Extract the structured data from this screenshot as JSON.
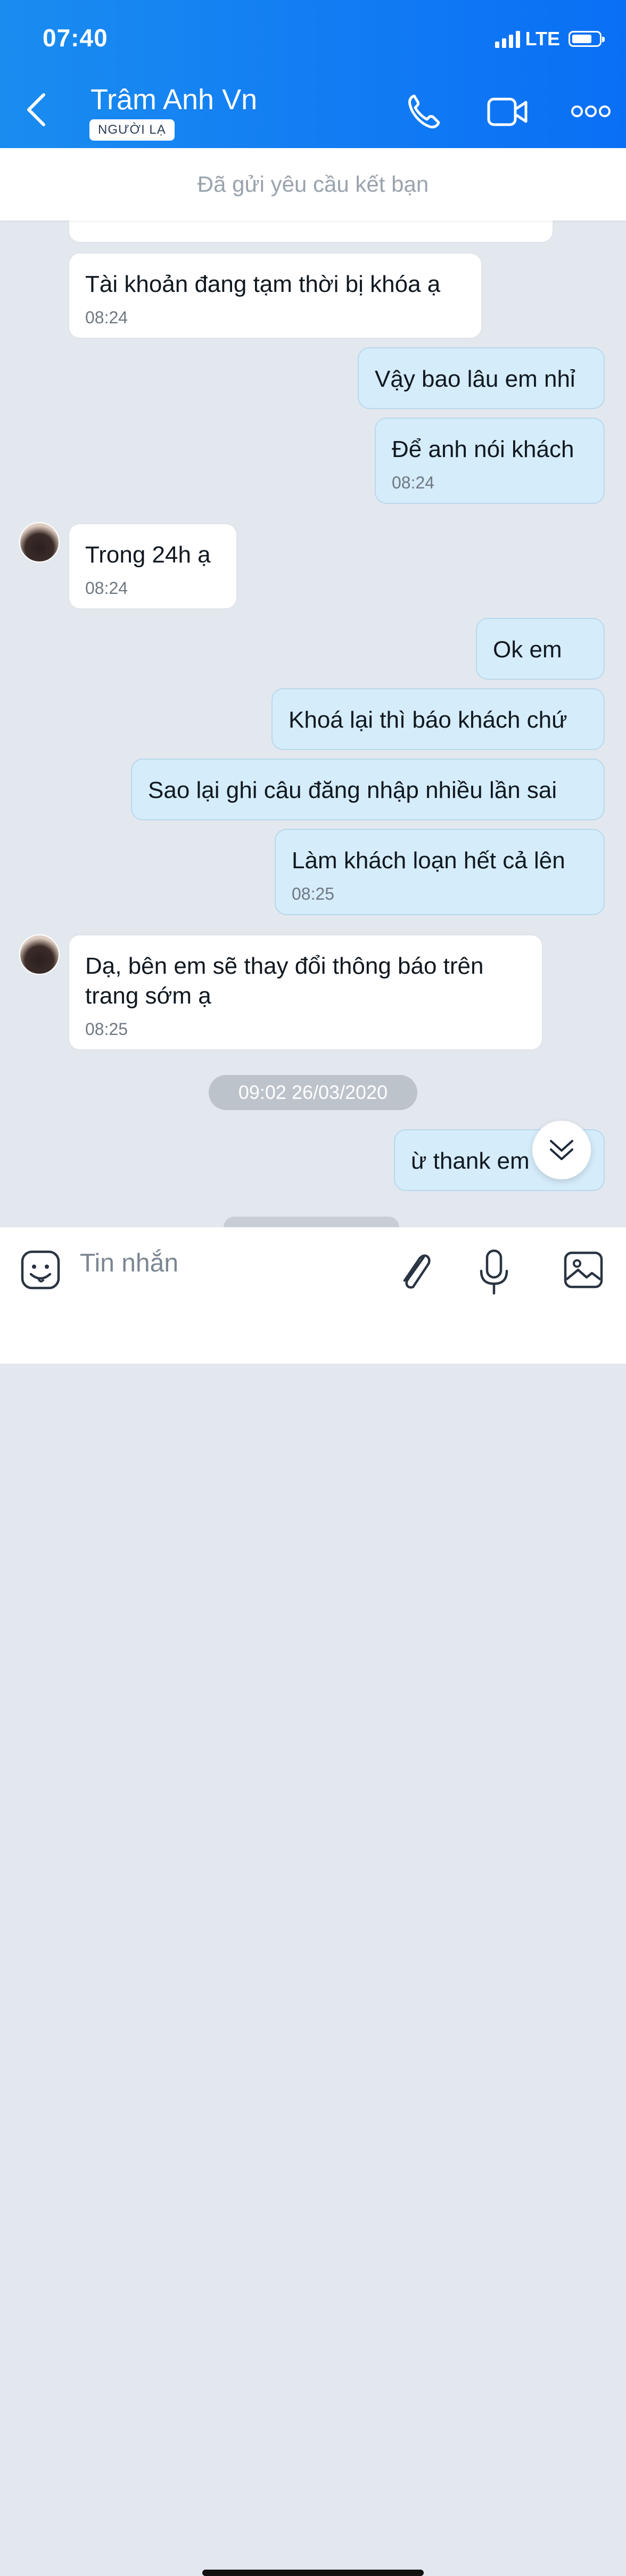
{
  "status_bar": {
    "time": "07:40",
    "network": "LTE"
  },
  "header": {
    "contact_name": "Trâm Anh Vn",
    "badge": "NGƯỜI LẠ",
    "accent_color": "#0a78f5",
    "icons": [
      "back-chevron-icon",
      "phone-icon",
      "video-call-icon",
      "more-options-icon"
    ]
  },
  "friend_request_bar": {
    "text": "Đã gửi yêu cầu kết bạn"
  },
  "messages": [
    {
      "side": "in",
      "text": "Tài khoản đang tạm thời bị khóa ạ",
      "time": "08:24"
    },
    {
      "side": "out",
      "text": "Vậy bao lâu em nhỉ"
    },
    {
      "side": "out",
      "text": "Để anh nói khách",
      "time": "08:24"
    },
    {
      "side": "in",
      "text": "Trong 24h ạ",
      "time": "08:24"
    },
    {
      "side": "out",
      "text": "Ok em"
    },
    {
      "side": "out",
      "text": "Khoá lại thì báo khách chứ"
    },
    {
      "side": "out",
      "text": "Sao lại ghi câu đăng nhập nhiều lần sai"
    },
    {
      "side": "out",
      "text": "Làm khách loạn hết cả lên",
      "time": "08:25"
    },
    {
      "side": "in",
      "text": "Dạ, bên em sẽ thay đổi thông báo trên trang sớm ạ",
      "time": "08:25"
    },
    {
      "side": "out",
      "text": "ừ thank em"
    }
  ],
  "date_separator": "09:02 26/03/2020",
  "composer": {
    "placeholder": "Tin nhắn",
    "icons": [
      "sticker-icon",
      "attachment-icon",
      "microphone-icon",
      "image-icon"
    ]
  }
}
